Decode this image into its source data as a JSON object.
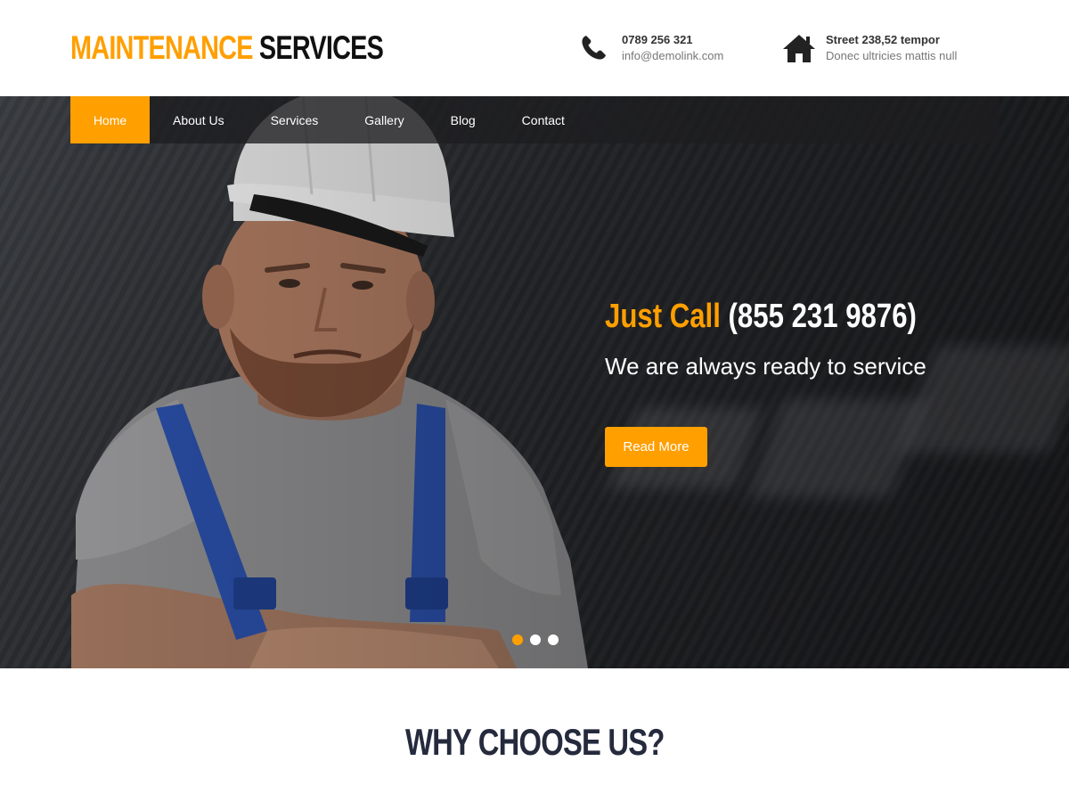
{
  "brand": {
    "name_accent": "MAINTENANCE",
    "name_dark": "SERVICES",
    "accent_color": "#ff9f00",
    "dark_color": "#111111"
  },
  "contact": {
    "phone_icon": "phone-icon",
    "phone": "0789 256 321",
    "email": "info@demolink.com",
    "address_icon": "home-icon",
    "address_line1": "Street 238,52 tempor",
    "address_line2": "Donec ultricies mattis null"
  },
  "nav": {
    "items": [
      {
        "label": "Home",
        "active": true
      },
      {
        "label": "About Us",
        "active": false
      },
      {
        "label": "Services",
        "active": false
      },
      {
        "label": "Gallery",
        "active": false
      },
      {
        "label": "Blog",
        "active": false
      },
      {
        "label": "Contact",
        "active": false
      }
    ]
  },
  "hero": {
    "title_accent": "Just Call",
    "title_phone": "(855 231 9876)",
    "subtitle": "We are always ready to service",
    "cta_label": "Read More",
    "slides": 3,
    "active_slide": 1
  },
  "section": {
    "title": "WHY CHOOSE US?",
    "title_color": "#252a3d"
  }
}
